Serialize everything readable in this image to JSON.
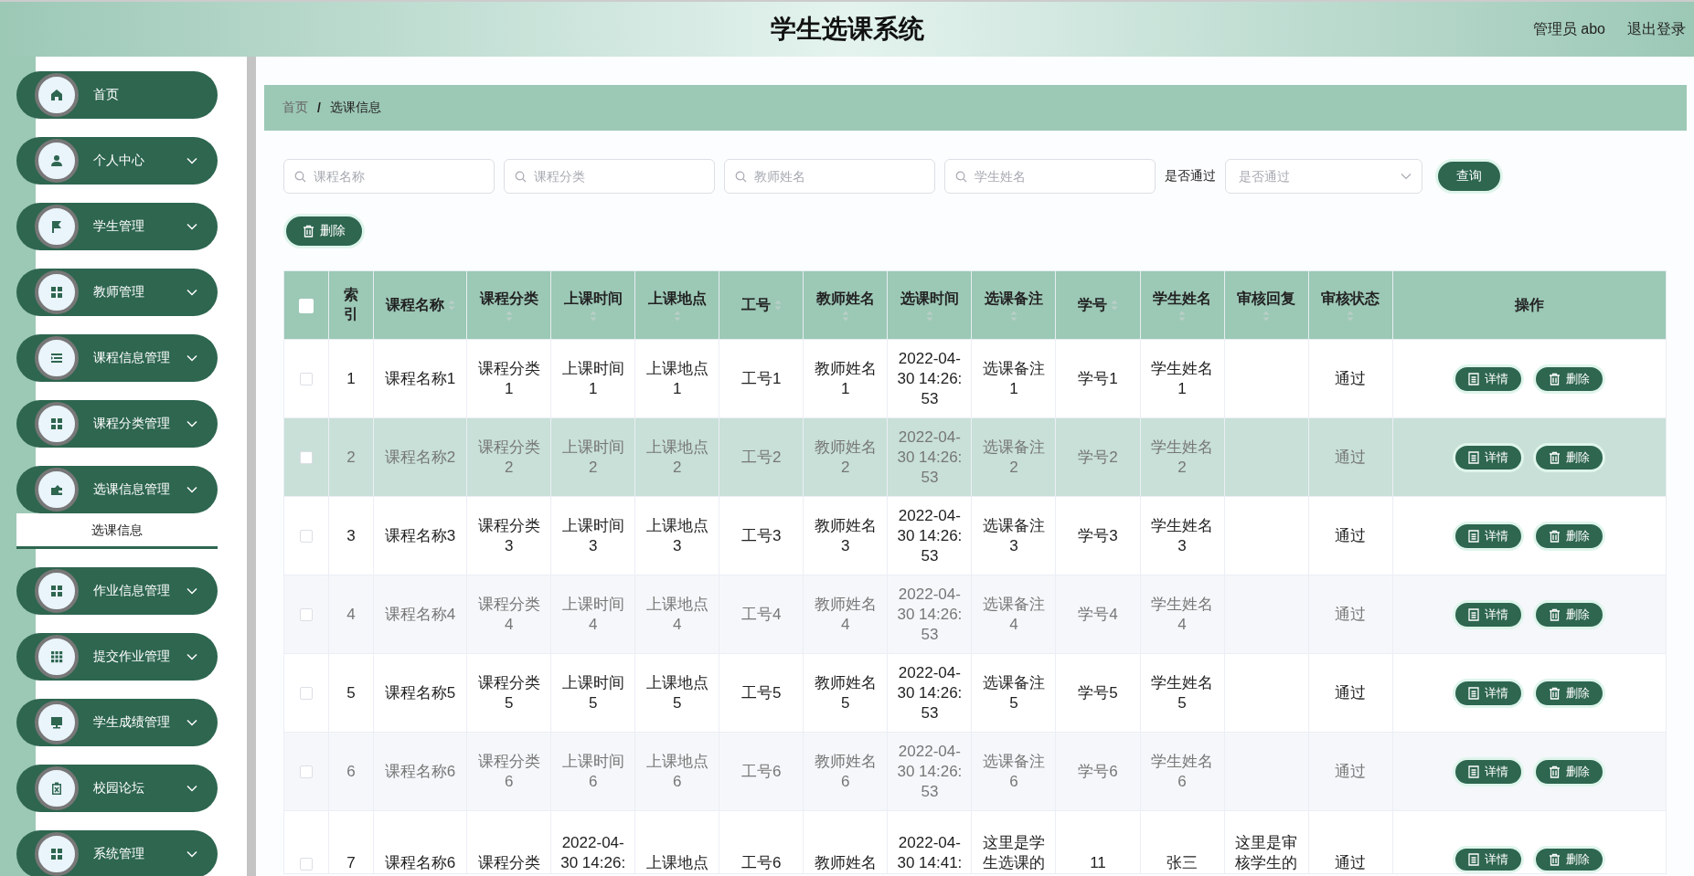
{
  "header": {
    "title": "学生选课系统",
    "user": "管理员 abo",
    "logout": "退出登录"
  },
  "sidebar": {
    "items": [
      {
        "label": "首页",
        "kind": "link"
      },
      {
        "label": "个人中心",
        "kind": "menu"
      },
      {
        "label": "学生管理",
        "kind": "menu"
      },
      {
        "label": "教师管理",
        "kind": "menu"
      },
      {
        "label": "课程信息管理",
        "kind": "menu"
      },
      {
        "label": "课程分类管理",
        "kind": "menu"
      },
      {
        "label": "选课信息管理",
        "kind": "menu",
        "children": [
          {
            "label": "选课信息",
            "selected": true
          }
        ]
      },
      {
        "label": "作业信息管理",
        "kind": "menu"
      },
      {
        "label": "提交作业管理",
        "kind": "menu"
      },
      {
        "label": "学生成绩管理",
        "kind": "menu"
      },
      {
        "label": "校园论坛",
        "kind": "menu"
      },
      {
        "label": "系统管理",
        "kind": "menu"
      }
    ]
  },
  "breadcrumb": {
    "items": [
      "首页",
      "选课信息"
    ],
    "separator": "/"
  },
  "search": {
    "fields": [
      {
        "placeholder": "课程名称"
      },
      {
        "placeholder": "课程分类"
      },
      {
        "placeholder": "教师姓名"
      },
      {
        "placeholder": "学生姓名"
      }
    ],
    "select_label": "是否通过",
    "select": {
      "placeholder": "是否通过"
    },
    "button": "查询"
  },
  "delete_button": "删除",
  "table": {
    "header_checkbox": {
      "checked": false
    },
    "columns": [
      {
        "label": "索引",
        "sortable": false
      },
      {
        "label": "课程名称",
        "sortable": true
      },
      {
        "label": "课程分类",
        "sortable": true
      },
      {
        "label": "上课时间",
        "sortable": true
      },
      {
        "label": "上课地点",
        "sortable": true
      },
      {
        "label": "工号",
        "sortable": true
      },
      {
        "label": "教师姓名",
        "sortable": true
      },
      {
        "label": "选课时间",
        "sortable": true
      },
      {
        "label": "选课备注",
        "sortable": true
      },
      {
        "label": "学号",
        "sortable": true
      },
      {
        "label": "学生姓名",
        "sortable": true
      },
      {
        "label": "审核回复",
        "sortable": true
      },
      {
        "label": "审核状态",
        "sortable": true
      },
      {
        "label": "操作",
        "sortable": false
      }
    ],
    "rows": [
      {
        "checked": false,
        "hovered": false,
        "cells": [
          "1",
          "课程名称1",
          "课程分类1",
          "上课时间1",
          "上课地点1",
          "工号1",
          "教师姓名1",
          "2022-04-30 14:26:53",
          "选课备注1",
          "学号1",
          "学生姓名1",
          "",
          "通过"
        ],
        "actions": [
          "详情",
          "删除"
        ]
      },
      {
        "checked": false,
        "hovered": true,
        "cells": [
          "2",
          "课程名称2",
          "课程分类2",
          "上课时间2",
          "上课地点2",
          "工号2",
          "教师姓名2",
          "2022-04-30 14:26:53",
          "选课备注2",
          "学号2",
          "学生姓名2",
          "",
          "通过"
        ],
        "actions": [
          "详情",
          "删除"
        ]
      },
      {
        "checked": false,
        "hovered": false,
        "cells": [
          "3",
          "课程名称3",
          "课程分类3",
          "上课时间3",
          "上课地点3",
          "工号3",
          "教师姓名3",
          "2022-04-30 14:26:53",
          "选课备注3",
          "学号3",
          "学生姓名3",
          "",
          "通过"
        ],
        "actions": [
          "详情",
          "删除"
        ]
      },
      {
        "checked": false,
        "hovered": false,
        "cells": [
          "4",
          "课程名称4",
          "课程分类4",
          "上课时间4",
          "上课地点4",
          "工号4",
          "教师姓名4",
          "2022-04-30 14:26:53",
          "选课备注4",
          "学号4",
          "学生姓名4",
          "",
          "通过"
        ],
        "actions": [
          "详情",
          "删除"
        ]
      },
      {
        "checked": false,
        "hovered": false,
        "cells": [
          "5",
          "课程名称5",
          "课程分类5",
          "上课时间5",
          "上课地点5",
          "工号5",
          "教师姓名5",
          "2022-04-30 14:26:53",
          "选课备注5",
          "学号5",
          "学生姓名5",
          "",
          "通过"
        ],
        "actions": [
          "详情",
          "删除"
        ]
      },
      {
        "checked": false,
        "hovered": false,
        "cells": [
          "6",
          "课程名称6",
          "课程分类6",
          "上课时间6",
          "上课地点6",
          "工号6",
          "教师姓名6",
          "2022-04-30 14:26:53",
          "选课备注6",
          "学号6",
          "学生姓名6",
          "",
          "通过"
        ],
        "actions": [
          "详情",
          "删除"
        ]
      },
      {
        "checked": false,
        "hovered": false,
        "cells": [
          "7",
          "课程名称6",
          "课程分类",
          "2022-04-30 14:26:",
          "上课地点",
          "工号6",
          "教师姓名",
          "2022-04-30 14:41:",
          "这里是学生选课的",
          "11",
          "张三",
          "这里是审核学生的",
          "通过"
        ],
        "actions": [
          "详情",
          "删除"
        ]
      }
    ]
  }
}
